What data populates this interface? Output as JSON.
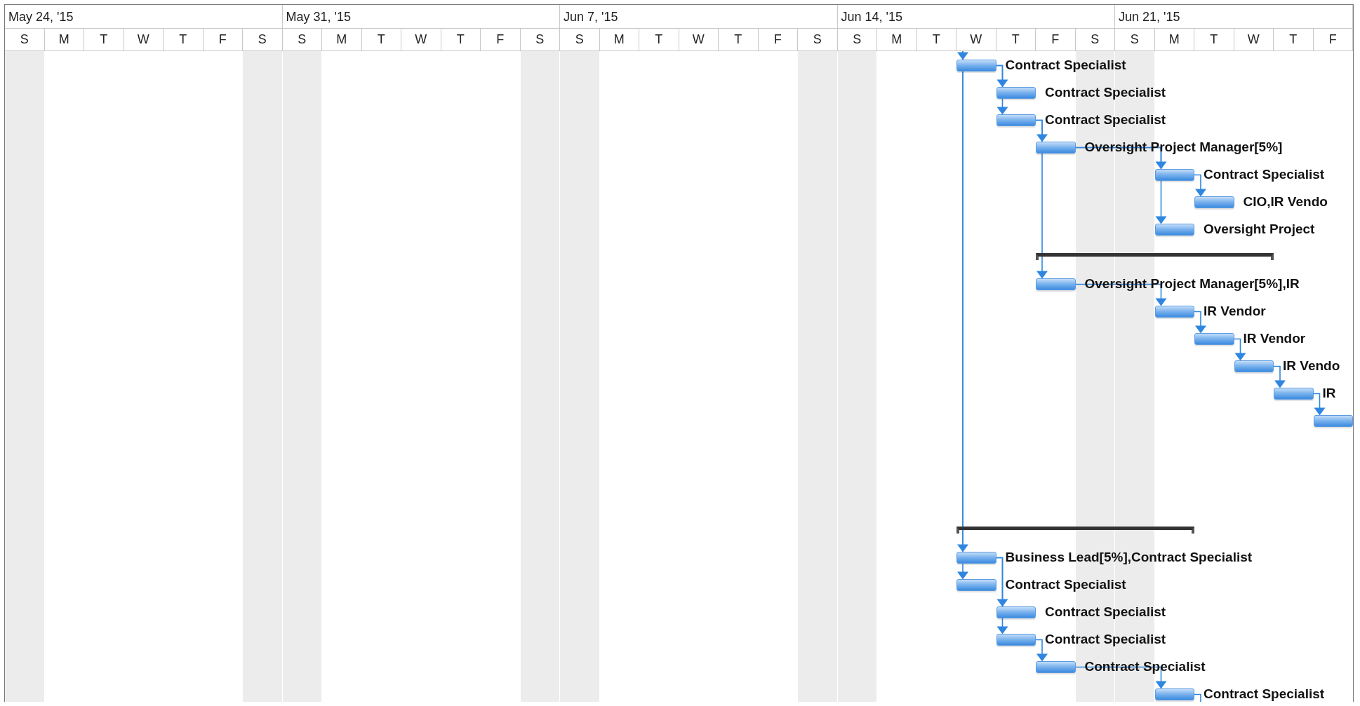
{
  "timescale": {
    "weeks": [
      "May 24, '15",
      "May 31, '15",
      "Jun 7, '15",
      "Jun 14, '15",
      "Jun 21, '15"
    ],
    "days": [
      {
        "letter": "S",
        "weekend": true
      },
      {
        "letter": "M",
        "weekend": false
      },
      {
        "letter": "T",
        "weekend": false
      },
      {
        "letter": "W",
        "weekend": false
      },
      {
        "letter": "T",
        "weekend": false
      },
      {
        "letter": "F",
        "weekend": false
      },
      {
        "letter": "S",
        "weekend": true
      },
      {
        "letter": "S",
        "weekend": true
      },
      {
        "letter": "M",
        "weekend": false
      },
      {
        "letter": "T",
        "weekend": false
      },
      {
        "letter": "W",
        "weekend": false
      },
      {
        "letter": "T",
        "weekend": false
      },
      {
        "letter": "F",
        "weekend": false
      },
      {
        "letter": "S",
        "weekend": true
      },
      {
        "letter": "S",
        "weekend": true
      },
      {
        "letter": "M",
        "weekend": false
      },
      {
        "letter": "T",
        "weekend": false
      },
      {
        "letter": "W",
        "weekend": false
      },
      {
        "letter": "T",
        "weekend": false
      },
      {
        "letter": "F",
        "weekend": false
      },
      {
        "letter": "S",
        "weekend": true
      },
      {
        "letter": "S",
        "weekend": true
      },
      {
        "letter": "M",
        "weekend": false
      },
      {
        "letter": "T",
        "weekend": false
      },
      {
        "letter": "W",
        "weekend": false
      },
      {
        "letter": "T",
        "weekend": false
      },
      {
        "letter": "F",
        "weekend": false
      },
      {
        "letter": "S",
        "weekend": true
      },
      {
        "letter": "S",
        "weekend": true
      },
      {
        "letter": "M",
        "weekend": false
      },
      {
        "letter": "T",
        "weekend": false
      },
      {
        "letter": "W",
        "weekend": false
      },
      {
        "letter": "T",
        "weekend": false
      },
      {
        "letter": "F",
        "weekend": false
      }
    ]
  },
  "rows": [
    {
      "kind": "task",
      "label": "Contract Specialist"
    },
    {
      "kind": "task",
      "label": "Contract Specialist"
    },
    {
      "kind": "task",
      "label": "Contract Specialist"
    },
    {
      "kind": "task",
      "label": "Oversight Project Manager[5%]"
    },
    {
      "kind": "task",
      "label": "Contract Specialist"
    },
    {
      "kind": "task",
      "label": "CIO,IR Vendo"
    },
    {
      "kind": "task",
      "label": "Oversight Project"
    },
    {
      "kind": "summary"
    },
    {
      "kind": "task",
      "label": "Oversight Project Manager[5%],IR"
    },
    {
      "kind": "task",
      "label": "IR Vendor"
    },
    {
      "kind": "task",
      "label": "IR Vendor"
    },
    {
      "kind": "task",
      "label": "IR Vendo"
    },
    {
      "kind": "task",
      "label": "IR"
    },
    {
      "kind": "task"
    },
    {
      "kind": "blank"
    },
    {
      "kind": "blank"
    },
    {
      "kind": "blank"
    },
    {
      "kind": "summary"
    },
    {
      "kind": "task",
      "label": "Business Lead[5%],Contract Specialist"
    },
    {
      "kind": "task",
      "label": "Contract Specialist"
    },
    {
      "kind": "task",
      "label": "Contract Specialist"
    },
    {
      "kind": "task",
      "label": "Contract Specialist"
    },
    {
      "kind": "task",
      "label": "Contract Specialist"
    },
    {
      "kind": "task",
      "label": "Contract Specialist"
    }
  ]
}
